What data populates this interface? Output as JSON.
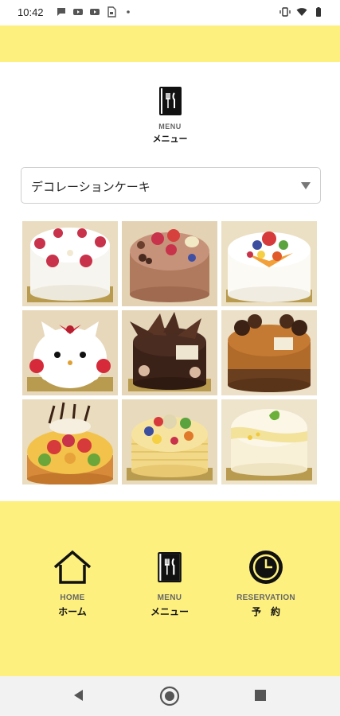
{
  "status_bar": {
    "time": "10:42",
    "left_icons": [
      "chat-icon",
      "youtube-icon",
      "youtube-icon",
      "sim-icon",
      "dot-icon"
    ],
    "right_icons": [
      "vibrate-icon",
      "wifi-icon",
      "battery-icon"
    ]
  },
  "header": {
    "icon": "menu-book-icon",
    "label_en": "MENU",
    "label_ja": "メニュー"
  },
  "category_select": {
    "selected": "デコレーションケーキ"
  },
  "cakes": [
    {
      "name": "strawberry-shortcake"
    },
    {
      "name": "chocolate-strawberry-cake"
    },
    {
      "name": "fruit-cream-cake"
    },
    {
      "name": "cat-face-cake"
    },
    {
      "name": "chocolate-leaf-cake"
    },
    {
      "name": "caramel-chocolate-cake"
    },
    {
      "name": "fruit-tart-cake"
    },
    {
      "name": "fruit-mille-crepe-cake"
    },
    {
      "name": "white-mousse-cake"
    }
  ],
  "bottom_nav": {
    "home": {
      "icon": "home-icon",
      "label_en": "HOME",
      "label_ja": "ホーム"
    },
    "menu": {
      "icon": "menu-book-icon",
      "label_en": "MENU",
      "label_ja": "メニュー"
    },
    "reservation": {
      "icon": "clock-icon",
      "label_en": "RESERVATION",
      "label_ja": "予　約"
    }
  },
  "colors": {
    "accent_yellow": "#fdf07e",
    "text_dark": "#111111",
    "text_grey": "#666666"
  }
}
